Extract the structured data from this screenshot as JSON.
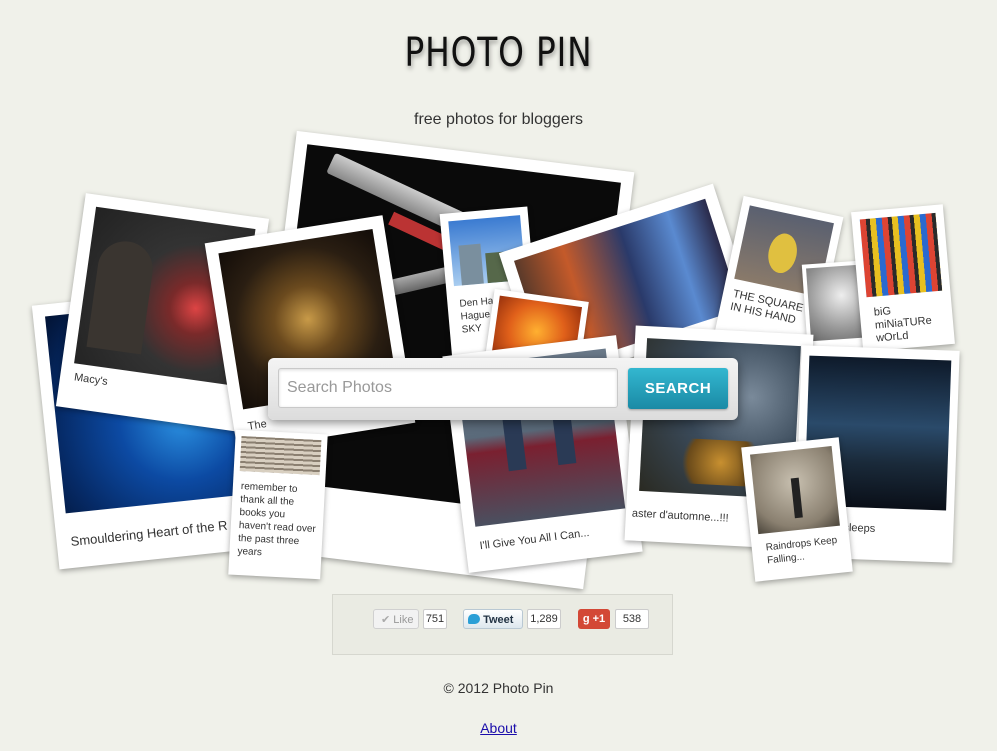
{
  "site": {
    "title": "PHOTO PIN",
    "subtitle": "free photos for bloggers"
  },
  "search": {
    "placeholder": "Search Photos",
    "button_label": "SEARCH"
  },
  "photos": [
    {
      "caption": "Smouldering Heart of the R"
    },
    {
      "caption": "Macy's"
    },
    {
      "caption": "The"
    },
    {
      "caption": "Den Haag Hague SUNS SKY"
    },
    {
      "caption": "remember to thank all the books you haven't read over the past three years"
    },
    {
      "caption": "I'll Give You All I Can..."
    },
    {
      "caption": "THE SQUARE IN HIS HAND"
    },
    {
      "caption": "biG miNiaTURe wOrLd"
    },
    {
      "caption": "aster d'automne...!!!"
    },
    {
      "caption": "ity sleeps"
    },
    {
      "caption": "Raindrops Keep Falling..."
    }
  ],
  "social": {
    "like_label": "Like",
    "like_count": "751",
    "tweet_label": "Tweet",
    "tweet_count": "1,289",
    "gplus_label": "+1",
    "gplus_count": "538"
  },
  "footer": {
    "copyright": "© 2012 Photo Pin",
    "about_link": "About"
  }
}
